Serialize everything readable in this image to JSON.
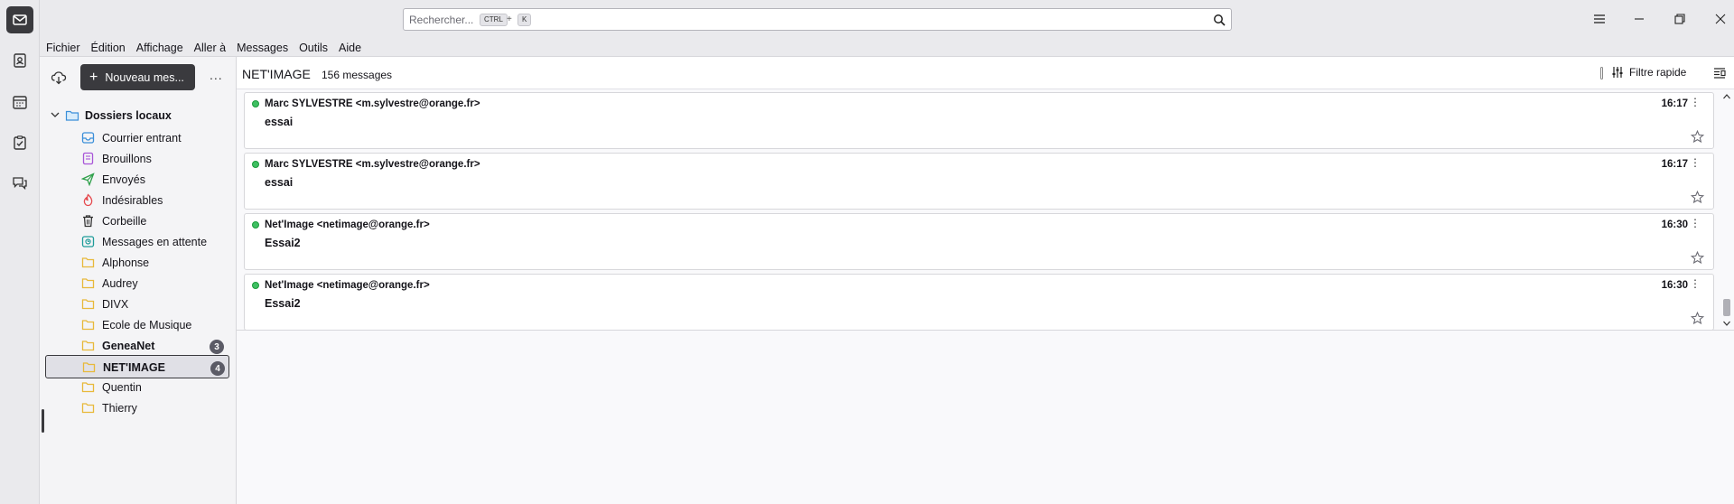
{
  "spaces": [
    "mail-icon",
    "address-book-icon",
    "calendar-icon",
    "tasks-icon",
    "chat-icon"
  ],
  "search": {
    "placeholder": "Rechercher...",
    "key1": "CTRL",
    "plus": "+",
    "key2": "K"
  },
  "menubar": {
    "items": [
      {
        "label": "Fichier"
      },
      {
        "label": "Édition"
      },
      {
        "label": "Affichage"
      },
      {
        "label": "Aller à"
      },
      {
        "label": "Messages"
      },
      {
        "label": "Outils"
      },
      {
        "label": "Aide"
      }
    ]
  },
  "folder_pane": {
    "new_message": "Nouveau mes...",
    "more": "...",
    "root": "Dossiers locaux",
    "folders": [
      {
        "label": "Courrier entrant",
        "icon": "inbox-icon"
      },
      {
        "label": "Brouillons",
        "icon": "drafts-icon"
      },
      {
        "label": "Envoyés",
        "icon": "sent-icon"
      },
      {
        "label": "Indésirables",
        "icon": "junk-icon"
      },
      {
        "label": "Corbeille",
        "icon": "trash-icon"
      },
      {
        "label": "Messages en attente",
        "icon": "outbox-icon"
      },
      {
        "label": "Alphonse",
        "icon": "folder-icon"
      },
      {
        "label": "Audrey",
        "icon": "folder-icon"
      },
      {
        "label": "DIVX",
        "icon": "folder-icon"
      },
      {
        "label": "Ecole de Musique",
        "icon": "folder-icon"
      },
      {
        "label": "GeneaNet",
        "icon": "folder-icon",
        "badge": "3",
        "bold": true
      },
      {
        "label": "NET'IMAGE",
        "icon": "folder-icon",
        "badge": "4",
        "bold": true,
        "selected": true
      },
      {
        "label": "Quentin",
        "icon": "folder-icon"
      },
      {
        "label": "Thierry",
        "icon": "folder-icon"
      }
    ]
  },
  "list_header": {
    "folder": "NET'IMAGE",
    "count": "156 messages",
    "quick_filter": "Filtre rapide"
  },
  "messages": [
    {
      "sender": "Marc SYLVESTRE <m.sylvestre@orange.fr>",
      "subject": "essai",
      "time": "16:17"
    },
    {
      "sender": "Marc SYLVESTRE <m.sylvestre@orange.fr>",
      "subject": "essai",
      "time": "16:17"
    },
    {
      "sender": "Net'Image <netimage@orange.fr>",
      "subject": "Essai2",
      "time": "16:30"
    },
    {
      "sender": "Net'Image <netimage@orange.fr>",
      "subject": "Essai2",
      "time": "16:30"
    }
  ],
  "colors": {
    "unread_dot": "#3fbf62",
    "folder_yellow": "#e8b93a",
    "accent_dark": "#3a3a3e",
    "root_folder_blue": "#3b8fd9"
  }
}
